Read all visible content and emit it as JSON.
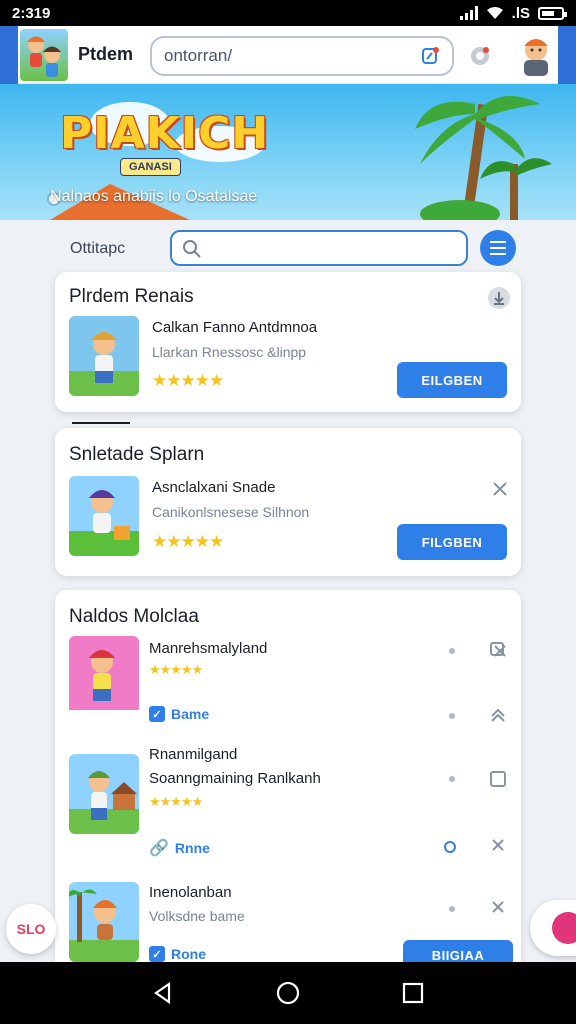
{
  "status_bar": {
    "time": "2:319",
    "network": ".lS"
  },
  "header": {
    "title": "Ptdem",
    "search_value": "ontorran/"
  },
  "banner": {
    "logo_text": "PIAKICH",
    "logo_sub": "GANASI",
    "tagline": "Nalnaos anabiis lo Osatalsae"
  },
  "filter": {
    "label": "Ottitapc"
  },
  "card1": {
    "title": "Plrdem Renais",
    "item_name": "Calkan Fanno Antdmnoa",
    "item_desc": "Llarkan Rnessosc &linpp",
    "rating": "★★★★★",
    "button": "EILGBEN"
  },
  "card2": {
    "title": "Snletade Splarn",
    "item_name": "Asnclalxani Snade",
    "item_desc": "Canikonlsnesese Silhnon",
    "rating": "★★★★★",
    "button": "FILGBEN"
  },
  "card3": {
    "title": "Naldos Molclaa",
    "items": [
      {
        "name": "Manrehsmalyland",
        "rating": "★★★★★",
        "tag": "Bame"
      },
      {
        "name": "Rnanmilgand",
        "name2": "Soanngmaining Ranlkanh",
        "rating": "★★★★★",
        "tag": "Rnne"
      },
      {
        "name": "Inenolanban",
        "desc": "Volksdne bame",
        "tag": "Rone",
        "button": "BIIGIAA"
      }
    ]
  },
  "floating": {
    "left_badge": "SLO"
  },
  "colors": {
    "accent": "#2f7fe8",
    "star": "#f6c31b",
    "banner_sky": "#3db6ef"
  }
}
